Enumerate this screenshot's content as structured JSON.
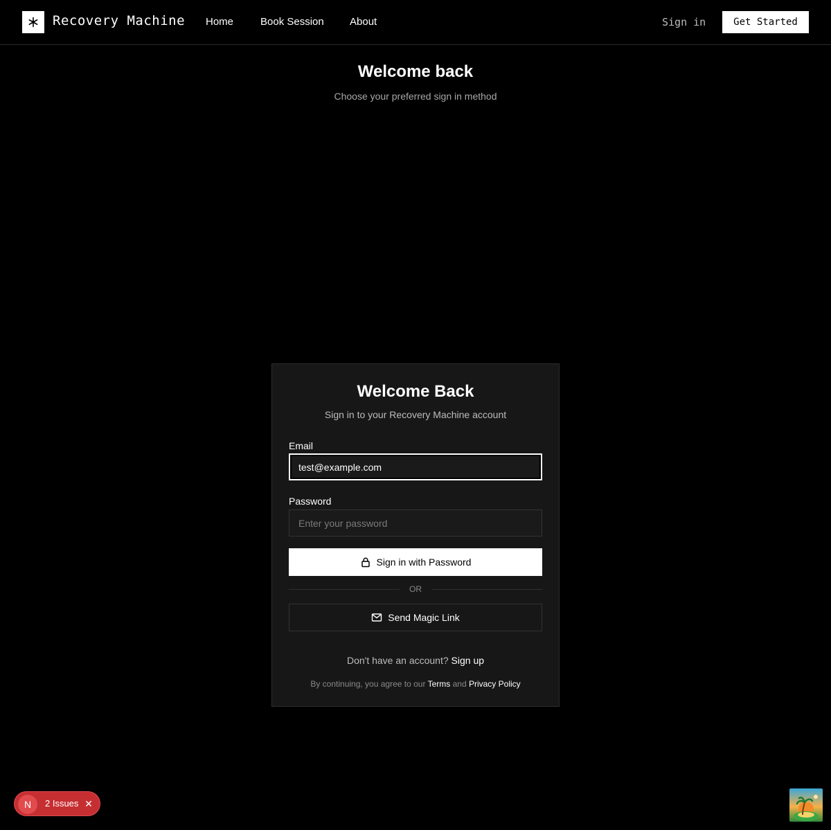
{
  "header": {
    "brand": "Recovery Machine",
    "nav": [
      "Home",
      "Book Session",
      "About"
    ],
    "sign_in": "Sign in",
    "get_started": "Get Started"
  },
  "page": {
    "title": "Welcome back",
    "subtitle": "Choose your preferred sign in method"
  },
  "card": {
    "title": "Welcome Back",
    "subtitle": "Sign in to your Recovery Machine account",
    "email_label": "Email",
    "email_value": "test@example.com",
    "password_label": "Password",
    "password_placeholder": "Enter your password",
    "password_button": "Sign in with Password",
    "divider": "OR",
    "magic_link_button": "Send Magic Link",
    "signup_prompt": "Don't have an account?",
    "signup_link": "Sign up",
    "legal_prefix": "By continuing, you agree to our",
    "terms_link": "Terms",
    "legal_and": "and",
    "privacy_link": "Privacy Policy"
  },
  "issues_badge": {
    "letter": "N",
    "text": "2 Issues",
    "close": "✕"
  },
  "colors": {
    "background": "#000000",
    "card": "#171717",
    "issues": "#c62f32"
  },
  "icons": [
    "snowflake-icon",
    "lock-icon",
    "mail-icon",
    "close-icon",
    "island-icon"
  ]
}
